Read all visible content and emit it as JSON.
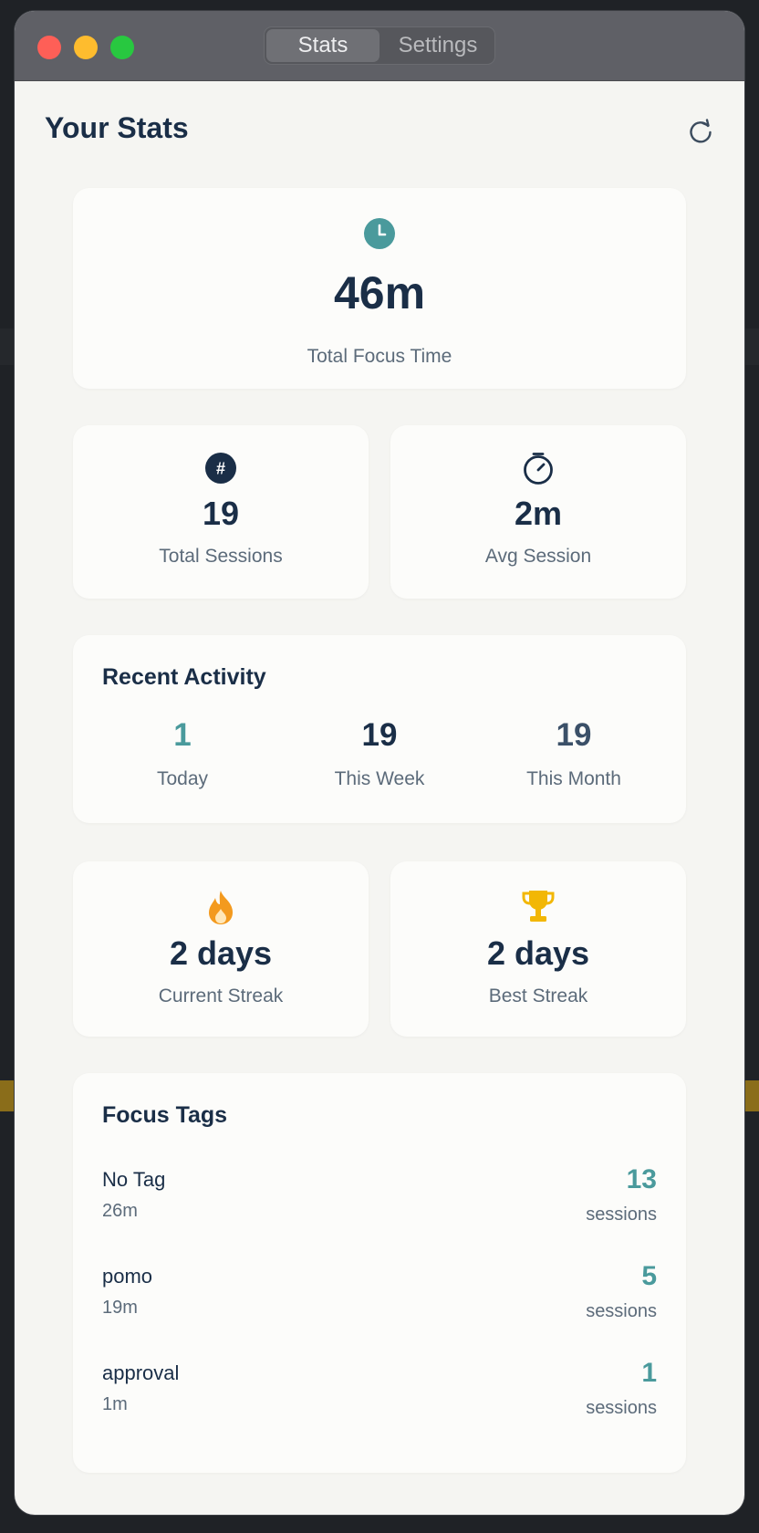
{
  "window": {
    "tabs": [
      {
        "label": "Stats",
        "active": true
      },
      {
        "label": "Settings",
        "active": false
      }
    ]
  },
  "header": {
    "title": "Your Stats",
    "refresh_icon": "refresh-icon"
  },
  "focus_time": {
    "value": "46m",
    "label": "Total Focus Time",
    "icon": "clock-icon"
  },
  "total_sessions": {
    "value": "19",
    "label": "Total Sessions",
    "icon": "hash-icon"
  },
  "avg_session": {
    "value": "2m",
    "label": "Avg Session",
    "icon": "timer-icon"
  },
  "recent_activity": {
    "title": "Recent Activity",
    "items": [
      {
        "value": "1",
        "label": "Today"
      },
      {
        "value": "19",
        "label": "This Week"
      },
      {
        "value": "19",
        "label": "This Month"
      }
    ]
  },
  "current_streak": {
    "value": "2 days",
    "label": "Current Streak",
    "icon": "flame-icon"
  },
  "best_streak": {
    "value": "2 days",
    "label": "Best Streak",
    "icon": "trophy-icon"
  },
  "focus_tags": {
    "title": "Focus Tags",
    "items": [
      {
        "name": "No Tag",
        "time": "26m",
        "count": "13",
        "unit": "sessions"
      },
      {
        "name": "pomo",
        "time": "19m",
        "count": "5",
        "unit": "sessions"
      },
      {
        "name": "approval",
        "time": "1m",
        "count": "1",
        "unit": "sessions"
      }
    ]
  },
  "colors": {
    "accent_teal": "#4a9a9c",
    "navy": "#1a2e47",
    "flame": "#f39a1e",
    "trophy": "#f2b705"
  }
}
